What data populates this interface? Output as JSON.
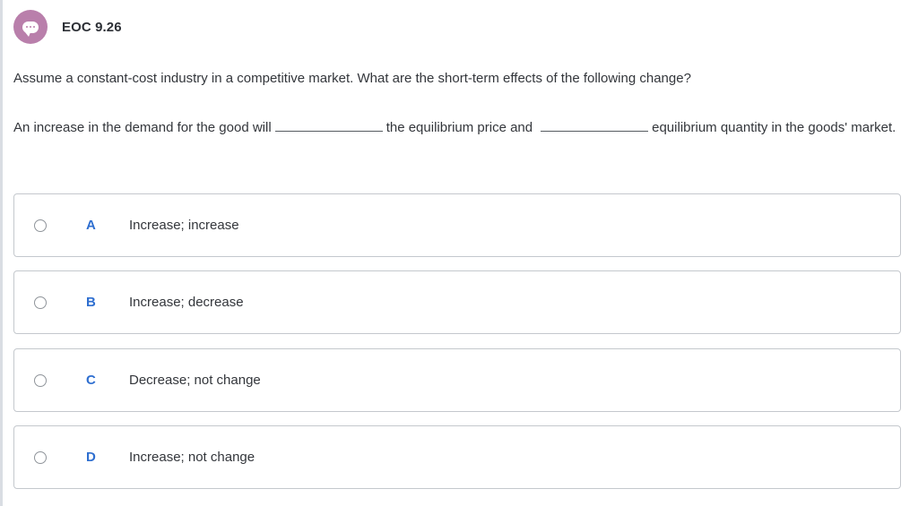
{
  "header": {
    "title": "EOC 9.26",
    "icon": "chat-bubble-icon",
    "badge_color": "#b97fab"
  },
  "question": "Assume a constant-cost industry in a competitive market. What are the short-term effects of the following change?",
  "prompt": {
    "part1": "An increase in the demand for the good will",
    "part2": "the equilibrium price and",
    "part3": "equilibrium quantity in the goods' market."
  },
  "options": [
    {
      "letter": "A",
      "text": "Increase; increase"
    },
    {
      "letter": "B",
      "text": "Increase; decrease"
    },
    {
      "letter": "C",
      "text": "Decrease; not change"
    },
    {
      "letter": "D",
      "text": "Increase; not change"
    }
  ],
  "colors": {
    "accent": "#2f6fd0",
    "border": "#c4c8cd",
    "text": "#33363b"
  }
}
